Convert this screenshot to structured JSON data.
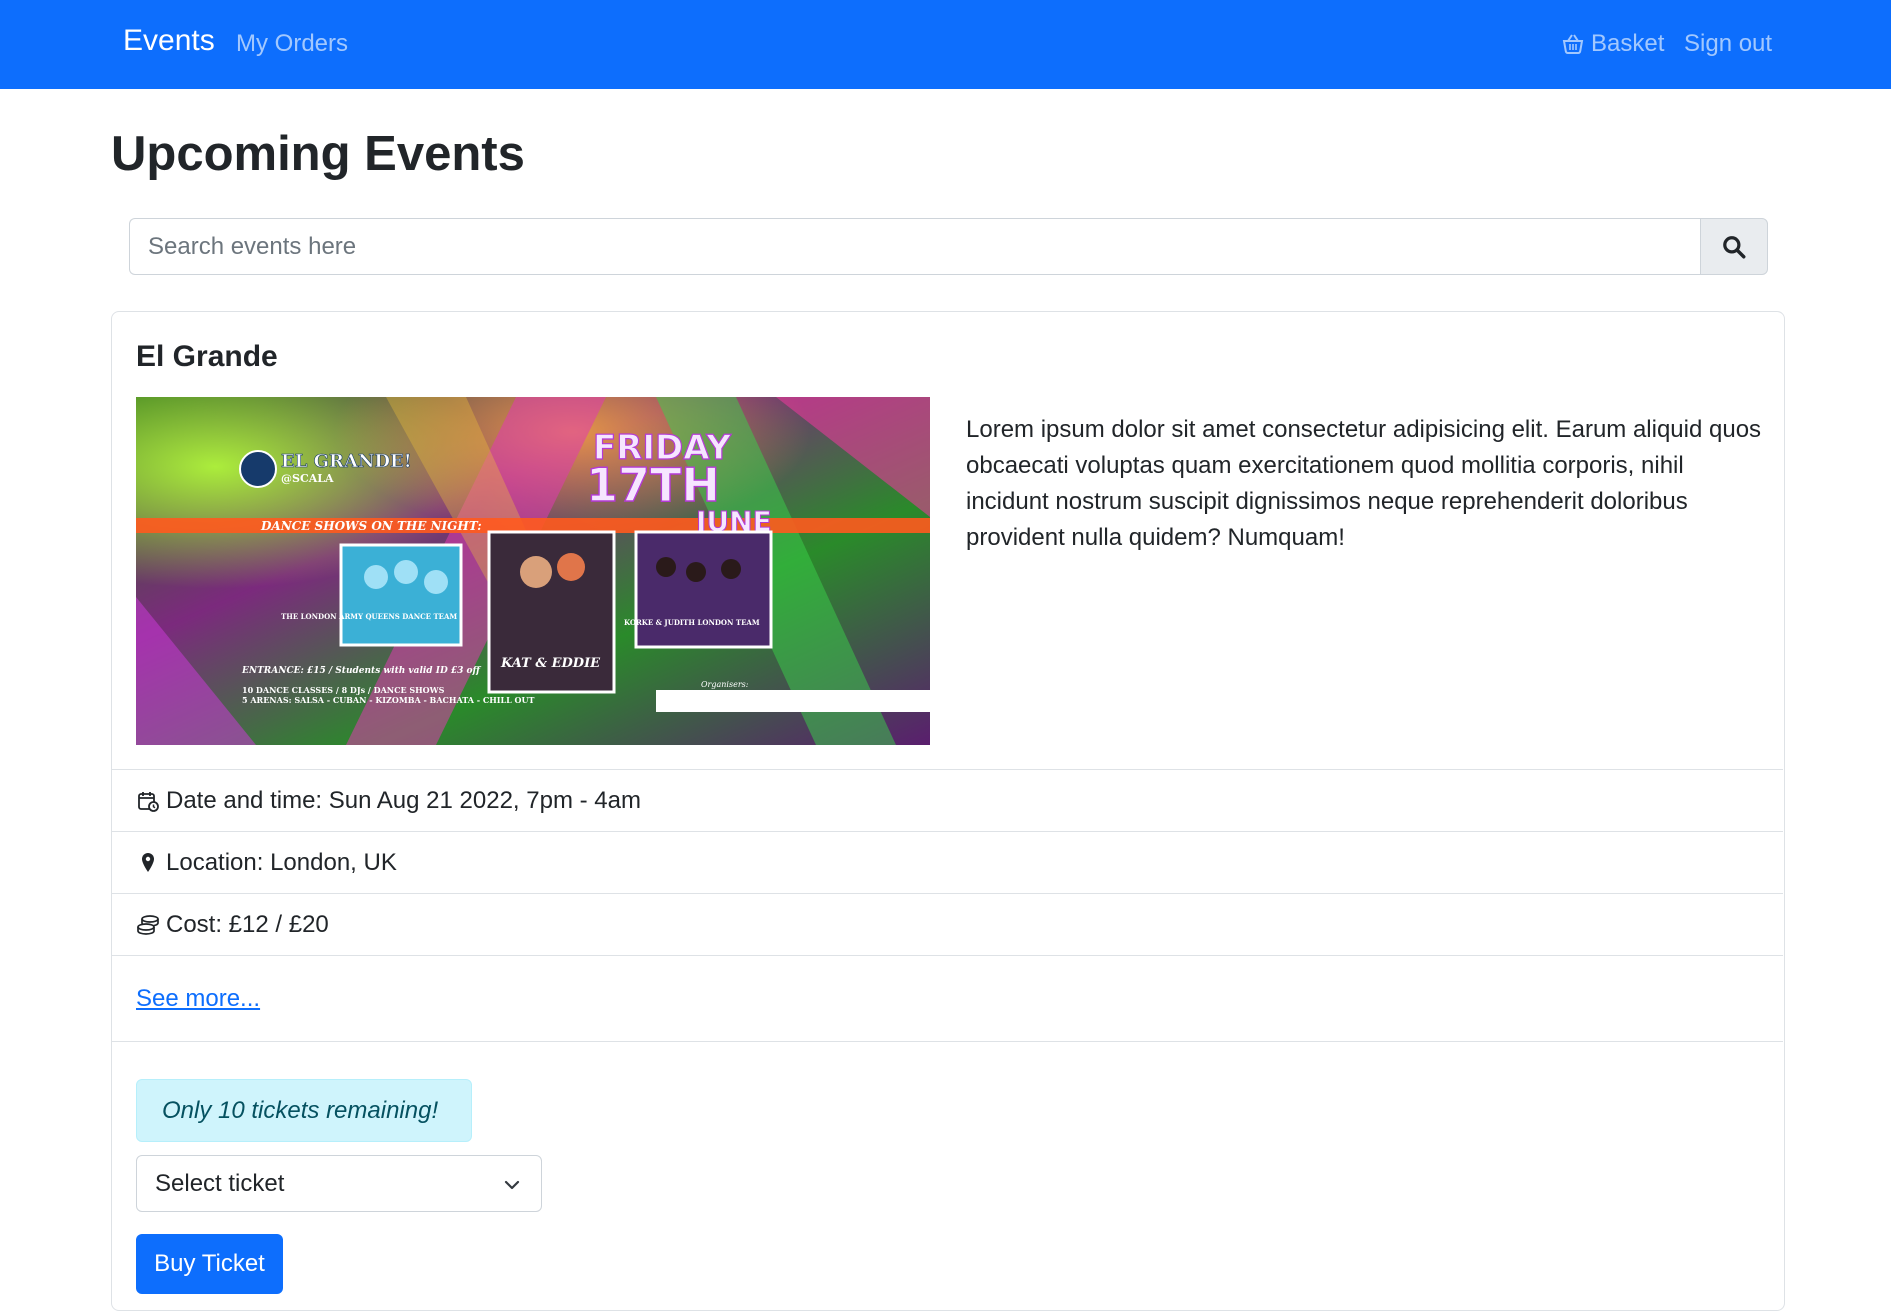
{
  "navbar": {
    "brand": "Events",
    "my_orders": "My Orders",
    "basket": "Basket",
    "basket_icon": "basket-icon",
    "sign_out": "Sign out",
    "color": "#0d6efd"
  },
  "page": {
    "title": "Upcoming Events"
  },
  "search": {
    "placeholder": "Search events here",
    "value": "",
    "button_icon": "search-icon"
  },
  "event": {
    "title": "El Grande",
    "image_alt": "El Grande @ Scala event poster",
    "poster": {
      "heading_line1": "FRIDAY",
      "heading_line2": "17TH",
      "heading_line3": "JUNE",
      "logo_title": "EL GRANDE!",
      "logo_subtitle": "@SCALA",
      "banner": "DANCE SHOWS ON THE NIGHT:",
      "team1": "THE LONDON ARMY QUEENS DANCE TEAM",
      "team2": "KAT & EDDIE",
      "team3": "KORKE & JUDITH LONDON TEAM",
      "entrance": "ENTRANCE: £15 / Students with valid ID £3 off",
      "classes": "10 DANCE CLASSES / 8 DJs / DANCE SHOWS",
      "arenas": "5 ARENAS: SALSA - CUBAN - KIZOMBA - BACHATA - CHILL OUT",
      "organisers": "Organisers:"
    },
    "description": "Lorem ipsum dolor sit amet consectetur adipisicing elit. Earum aliquid quos obcaecati voluptas quam exercitationem quod mollitia corporis, nihil incidunt nostrum suscipit dignissimos neque reprehenderit doloribus provident nulla quidem? Numquam!",
    "date_label": "Date and time: Sun Aug 21 2022, 7pm - 4am",
    "location_label": "Location: London, UK",
    "cost_label": "Cost: £12 / £20",
    "see_more": "See more...",
    "tickets_alert": "Only 10 tickets remaining!",
    "select_value": "Select ticket",
    "buy_button": "Buy Ticket",
    "icons": {
      "date": "calendar-clock-icon",
      "location": "map-pin-icon",
      "cost": "coins-icon",
      "select": "chevron-down-icon"
    }
  }
}
